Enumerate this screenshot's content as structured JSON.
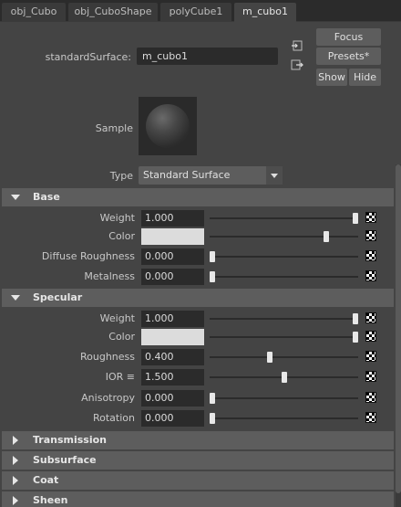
{
  "tabs": [
    "obj_Cubo",
    "obj_CuboShape",
    "polyCube1",
    "m_cubo1"
  ],
  "header": {
    "standard_surface_label": "standardSurface:",
    "standard_surface_value": "m_cubo1",
    "focus_label": "Focus",
    "presets_label": "Presets*",
    "show_label": "Show",
    "hide_label": "Hide"
  },
  "sample": {
    "label": "Sample"
  },
  "type": {
    "label": "Type",
    "value": "Standard Surface"
  },
  "sections": {
    "base": {
      "title": "Base",
      "weight": {
        "label": "Weight",
        "value": "1.000",
        "fraction": 1.0
      },
      "color": {
        "label": "Color",
        "hex": "#dcdcdc",
        "fraction": 0.8
      },
      "diffuse_roughness": {
        "label": "Diffuse Roughness",
        "value": "0.000",
        "fraction": 0.0
      },
      "metalness": {
        "label": "Metalness",
        "value": "0.000",
        "fraction": 0.0
      }
    },
    "specular": {
      "title": "Specular",
      "weight": {
        "label": "Weight",
        "value": "1.000",
        "fraction": 1.0
      },
      "color": {
        "label": "Color",
        "hex": "#dcdcdc",
        "fraction": 1.0
      },
      "roughness": {
        "label": "Roughness",
        "value": "0.400",
        "fraction": 0.4
      },
      "ior": {
        "label": "IOR ≡",
        "value": "1.500",
        "fraction": 0.5
      },
      "anisotropy": {
        "label": "Anisotropy",
        "value": "0.000",
        "fraction": 0.0
      },
      "rotation": {
        "label": "Rotation",
        "value": "0.000",
        "fraction": 0.0
      }
    },
    "collapsed": [
      "Transmission",
      "Subsurface",
      "Coat",
      "Sheen"
    ]
  },
  "icons": {
    "input_connection": "arrow-left-box-icon",
    "output_connection": "arrow-right-box-icon",
    "map_button": "checker-map-icon"
  }
}
